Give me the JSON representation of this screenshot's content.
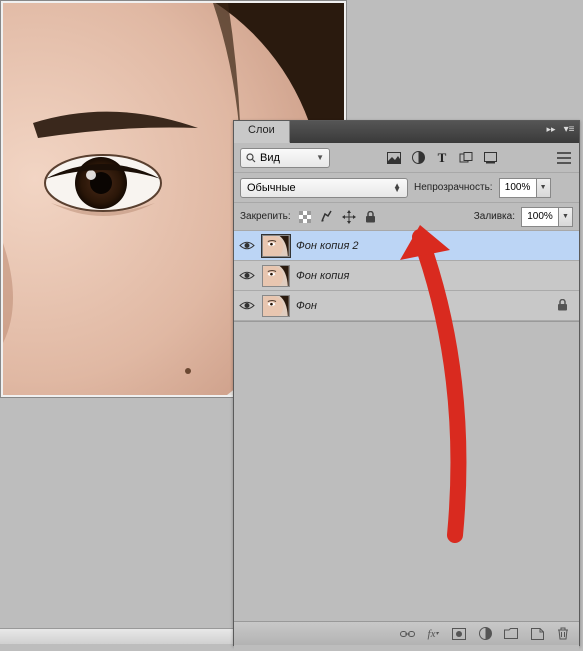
{
  "panel": {
    "tab_label": "Слои",
    "search_label": "Вид",
    "blend_mode": "Обычные",
    "opacity_label": "Непрозрачность:",
    "opacity_value": "100%",
    "fill_label": "Заливка:",
    "fill_value": "100%",
    "lock_label": "Закрепить:"
  },
  "layers": [
    {
      "name": "Фон копия 2",
      "visible": true,
      "locked": false,
      "selected": true
    },
    {
      "name": "Фон копия",
      "visible": true,
      "locked": false,
      "selected": false
    },
    {
      "name": "Фон",
      "visible": true,
      "locked": true,
      "selected": false
    }
  ],
  "icons": {
    "filter_image": "image-filter",
    "filter_adjust": "adjustment-filter",
    "filter_text": "T",
    "filter_shape": "shape-filter",
    "filter_smart": "smart-filter"
  }
}
